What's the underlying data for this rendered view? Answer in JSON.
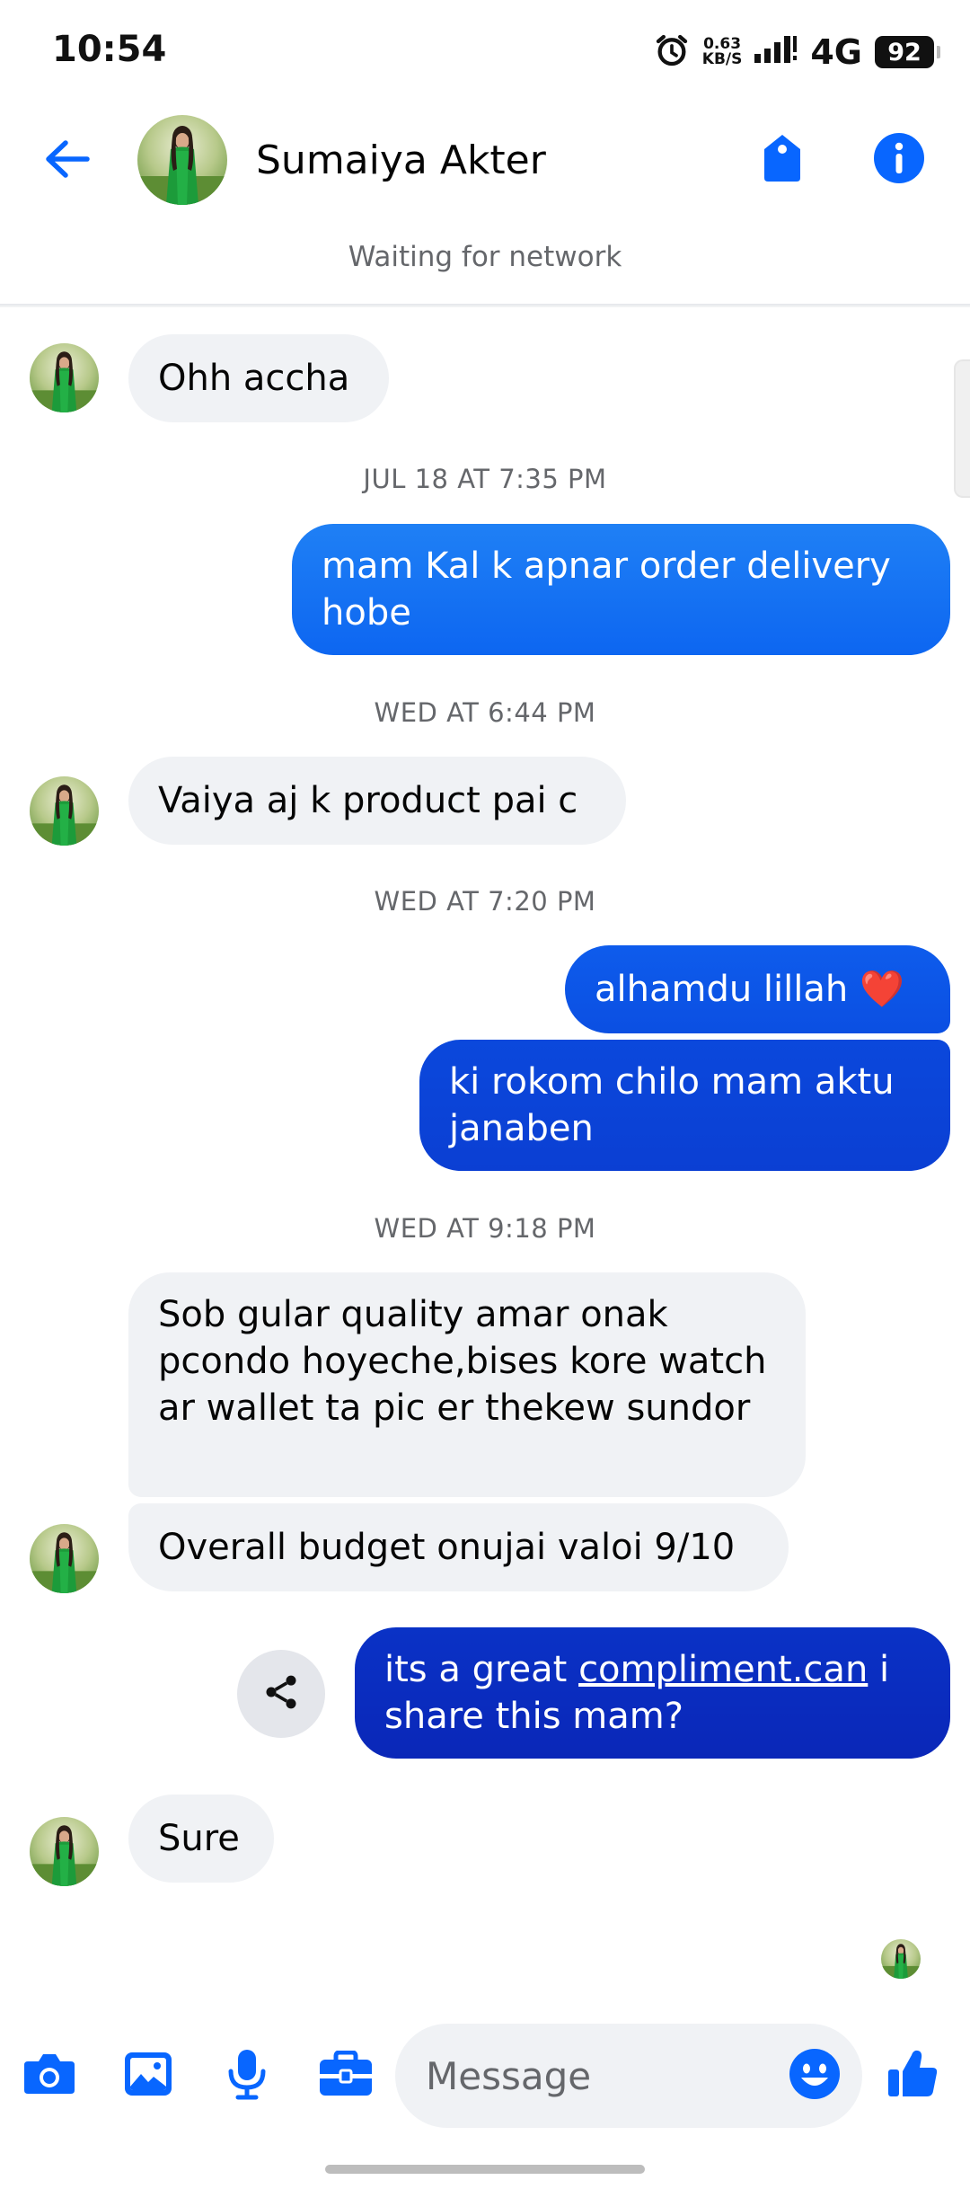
{
  "status_bar": {
    "time": "10:54",
    "speed_value": "0.63",
    "speed_unit": "KB/S",
    "network": "4G",
    "battery": "92"
  },
  "header": {
    "contact_name": "Sumaiya Akter",
    "network_status": "Waiting for network"
  },
  "messages": [
    {
      "type": "incoming",
      "text": "Ohh accha"
    },
    {
      "type": "timestamp",
      "text": "JUL 18 AT 7:35 PM"
    },
    {
      "type": "outgoing",
      "text": "mam Kal k apnar order delivery hobe"
    },
    {
      "type": "timestamp",
      "text": "WED AT 6:44 PM"
    },
    {
      "type": "incoming",
      "text": "Vaiya aj k product pai c"
    },
    {
      "type": "timestamp",
      "text": "WED AT 7:20 PM"
    },
    {
      "type": "outgoing",
      "text": "alhamdu lillah ❤️"
    },
    {
      "type": "outgoing",
      "text": "ki rokom chilo mam aktu janaben"
    },
    {
      "type": "timestamp",
      "text": "WED AT 9:18 PM"
    },
    {
      "type": "incoming",
      "text": "Sob gular quality amar onak pcondo hoyeche,bises kore watch ar wallet ta pic er thekew sundor"
    },
    {
      "type": "incoming",
      "text": "Overall budget onujai valoi 9/10"
    },
    {
      "type": "outgoing",
      "text_before": "its a great ",
      "link": "compliment.can",
      "text_after": " i share this mam?"
    },
    {
      "type": "incoming",
      "text": "Sure"
    }
  ],
  "composer": {
    "placeholder": "Message"
  },
  "icons": {
    "back": "back-arrow-icon",
    "tag": "tag-icon",
    "info": "info-icon",
    "share": "share-icon",
    "camera": "camera-icon",
    "gallery": "image-icon",
    "mic": "microphone-icon",
    "briefcase": "briefcase-icon",
    "emoji": "emoji-icon",
    "like": "thumbs-up-icon"
  },
  "colors": {
    "accent": "#0866ff",
    "outgoing_light": "#1877f2",
    "outgoing_dark": "#0a2fbf",
    "incoming_bg": "#f0f2f5",
    "secondary_text": "#65676b"
  }
}
